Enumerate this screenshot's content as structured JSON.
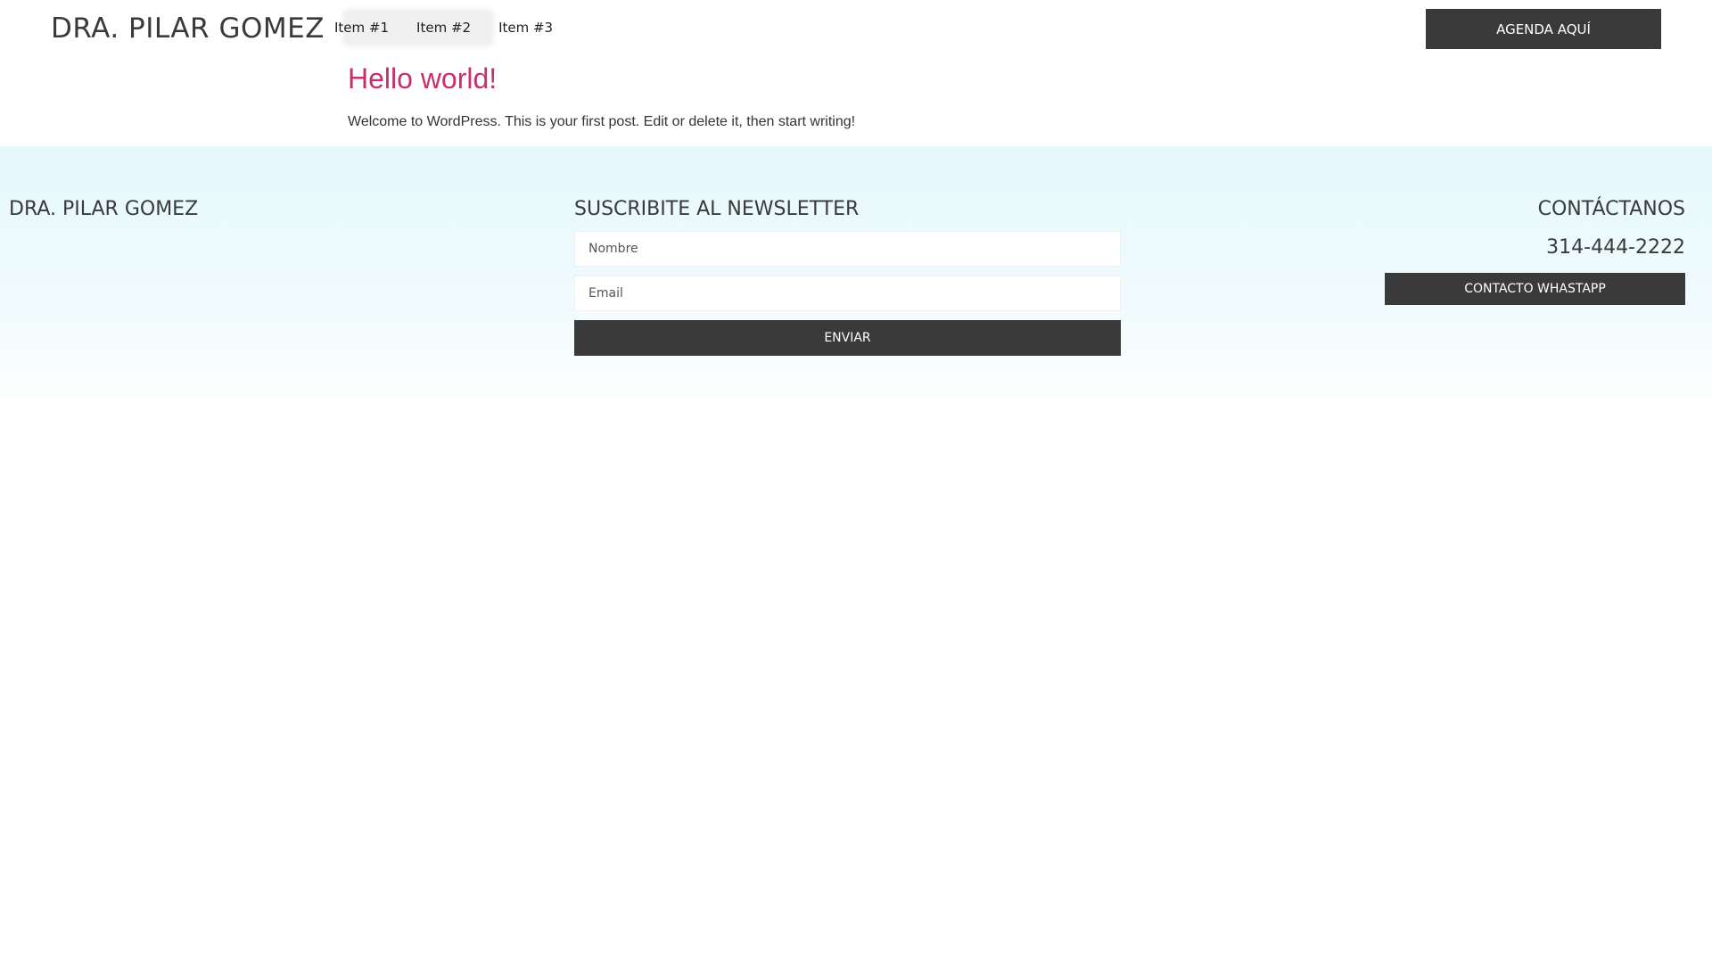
{
  "header": {
    "logo": "DRA. PILAR GOMEZ",
    "nav": [
      {
        "label": "Item #1"
      },
      {
        "label": "Item #2"
      },
      {
        "label": "Item #3"
      }
    ],
    "cta_label": "AGENDA AQUÍ"
  },
  "post": {
    "title": "Hello world!",
    "excerpt": "Welcome to WordPress. This is your first post. Edit or delete it, then start writing!"
  },
  "footer": {
    "brand": "DRA. PILAR GOMEZ",
    "newsletter": {
      "title": "SUSCRIBITE AL NEWSLETTER",
      "name_placeholder": "Nombre",
      "email_placeholder": "Email",
      "submit_label": "ENVIAR"
    },
    "contact": {
      "title": "CONTÁCTANOS",
      "phone": "314-444-2222",
      "whatsapp_label": "CONTACTO WHASTAPP"
    }
  },
  "colors": {
    "accent": "#c9306b",
    "button_bg": "#3a3a3a",
    "footer_bg_top": "#e5f8fc"
  }
}
